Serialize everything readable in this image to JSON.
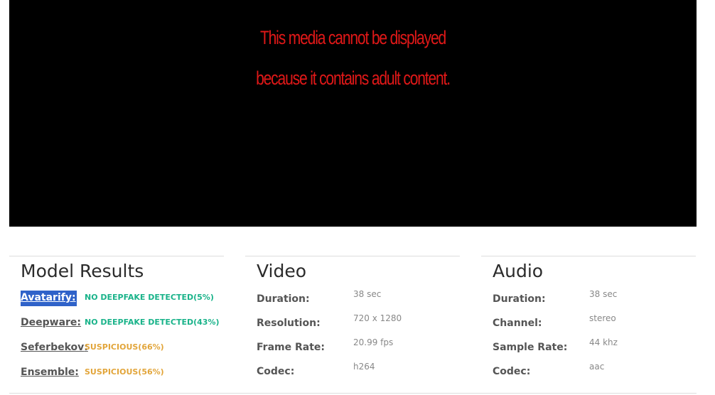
{
  "media": {
    "line1": "This media cannot be displayed",
    "line2": "because it contains adult content."
  },
  "model_results": {
    "title": "Model Results",
    "items": [
      {
        "name": "Avatarify",
        "verdict": "NO DEEPFAKE DETECTED(5%)",
        "status_color": "#1ab38a",
        "selected": true
      },
      {
        "name": "Deepware",
        "verdict": "NO DEEPFAKE DETECTED(43%)",
        "status_color": "#1ab38a",
        "selected": false
      },
      {
        "name": "Seferbekov",
        "verdict": "SUSPICIOUS(66%)",
        "status_color": "#e2a53a",
        "selected": false
      },
      {
        "name": "Ensemble",
        "verdict": "SUSPICIOUS(56%)",
        "status_color": "#e2a53a",
        "selected": false
      }
    ]
  },
  "video": {
    "title": "Video",
    "rows": [
      {
        "label": "Duration:",
        "value": "38 sec"
      },
      {
        "label": "Resolution:",
        "value": "720 x 1280"
      },
      {
        "label": "Frame Rate:",
        "value": "20.99 fps"
      },
      {
        "label": "Codec:",
        "value": "h264"
      }
    ]
  },
  "audio": {
    "title": "Audio",
    "rows": [
      {
        "label": "Duration:",
        "value": "38 sec"
      },
      {
        "label": "Channel:",
        "value": "stereo"
      },
      {
        "label": "Sample Rate:",
        "value": "44 khz"
      },
      {
        "label": "Codec:",
        "value": "aac"
      }
    ]
  }
}
